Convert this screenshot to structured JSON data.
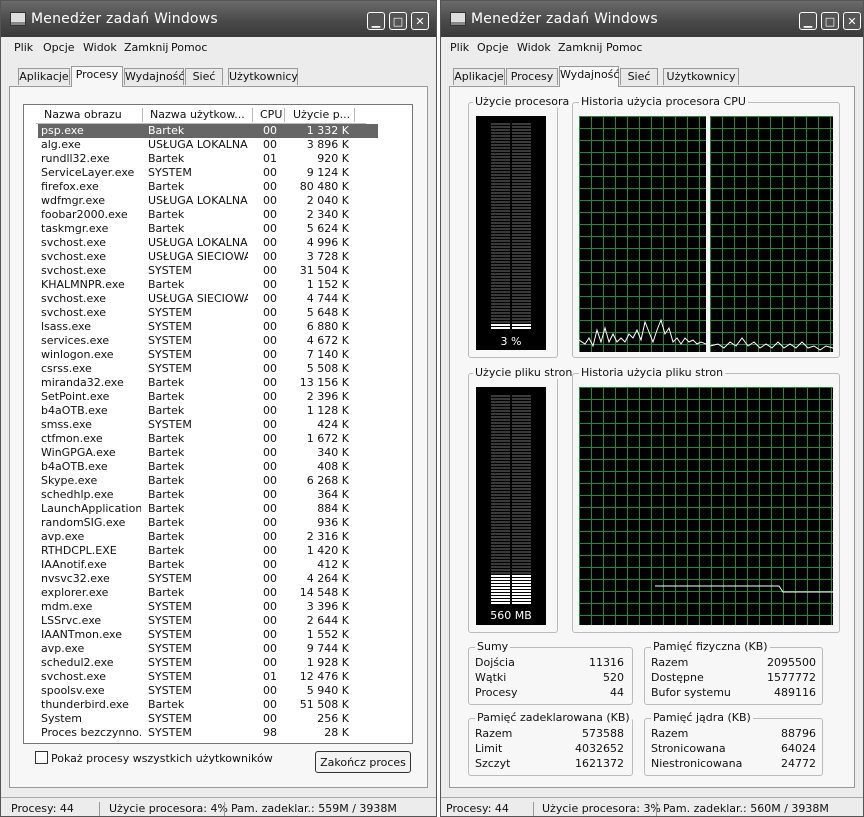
{
  "title": "Menedżer zadań Windows",
  "menu": [
    "Plik",
    "Opcje",
    "Widok",
    "Zamknij",
    "Pomoc"
  ],
  "tabs": [
    "Aplikacje",
    "Procesy",
    "Wydajność",
    "Sieć",
    "Użytkownicy"
  ],
  "processes": {
    "columns": [
      "Nazwa obrazu",
      "Nazwa użytkow...",
      "CPU",
      "Użycie p..."
    ],
    "rows": [
      [
        "psp.exe",
        "Bartek",
        "00",
        "1 332 K"
      ],
      [
        "alg.exe",
        "USŁUGA LOKALNA",
        "00",
        "3 896 K"
      ],
      [
        "rundll32.exe",
        "Bartek",
        "01",
        "920 K"
      ],
      [
        "ServiceLayer.exe",
        "SYSTEM",
        "00",
        "9 124 K"
      ],
      [
        "firefox.exe",
        "Bartek",
        "00",
        "80 480 K"
      ],
      [
        "wdfmgr.exe",
        "USŁUGA LOKALNA",
        "00",
        "2 040 K"
      ],
      [
        "foobar2000.exe",
        "Bartek",
        "00",
        "2 340 K"
      ],
      [
        "taskmgr.exe",
        "Bartek",
        "00",
        "5 624 K"
      ],
      [
        "svchost.exe",
        "USŁUGA LOKALNA",
        "00",
        "4 996 K"
      ],
      [
        "svchost.exe",
        "USŁUGA SIECIOWA",
        "00",
        "3 728 K"
      ],
      [
        "svchost.exe",
        "SYSTEM",
        "00",
        "31 504 K"
      ],
      [
        "KHALMNPR.exe",
        "Bartek",
        "00",
        "1 152 K"
      ],
      [
        "svchost.exe",
        "USŁUGA SIECIOWA",
        "00",
        "4 744 K"
      ],
      [
        "svchost.exe",
        "SYSTEM",
        "00",
        "5 648 K"
      ],
      [
        "lsass.exe",
        "SYSTEM",
        "00",
        "6 880 K"
      ],
      [
        "services.exe",
        "SYSTEM",
        "00",
        "4 672 K"
      ],
      [
        "winlogon.exe",
        "SYSTEM",
        "00",
        "7 140 K"
      ],
      [
        "csrss.exe",
        "SYSTEM",
        "00",
        "5 508 K"
      ],
      [
        "miranda32.exe",
        "Bartek",
        "00",
        "13 156 K"
      ],
      [
        "SetPoint.exe",
        "Bartek",
        "00",
        "2 396 K"
      ],
      [
        "b4aOTB.exe",
        "Bartek",
        "00",
        "1 128 K"
      ],
      [
        "smss.exe",
        "SYSTEM",
        "00",
        "424 K"
      ],
      [
        "ctfmon.exe",
        "Bartek",
        "00",
        "1 672 K"
      ],
      [
        "WinGPGA.exe",
        "Bartek",
        "00",
        "340 K"
      ],
      [
        "b4aOTB.exe",
        "Bartek",
        "00",
        "408 K"
      ],
      [
        "Skype.exe",
        "Bartek",
        "00",
        "6 268 K"
      ],
      [
        "schedhlp.exe",
        "Bartek",
        "00",
        "364 K"
      ],
      [
        "LaunchApplication...",
        "Bartek",
        "00",
        "884 K"
      ],
      [
        "randomSIG.exe",
        "Bartek",
        "00",
        "936 K"
      ],
      [
        "avp.exe",
        "Bartek",
        "00",
        "2 316 K"
      ],
      [
        "RTHDCPL.EXE",
        "Bartek",
        "00",
        "1 420 K"
      ],
      [
        "IAAnotif.exe",
        "Bartek",
        "00",
        "412 K"
      ],
      [
        "nvsvc32.exe",
        "SYSTEM",
        "00",
        "4 264 K"
      ],
      [
        "explorer.exe",
        "Bartek",
        "00",
        "14 548 K"
      ],
      [
        "mdm.exe",
        "SYSTEM",
        "00",
        "3 396 K"
      ],
      [
        "LSSrvc.exe",
        "SYSTEM",
        "00",
        "2 644 K"
      ],
      [
        "IAANTmon.exe",
        "SYSTEM",
        "00",
        "1 552 K"
      ],
      [
        "avp.exe",
        "SYSTEM",
        "00",
        "9 744 K"
      ],
      [
        "schedul2.exe",
        "SYSTEM",
        "00",
        "1 928 K"
      ],
      [
        "svchost.exe",
        "SYSTEM",
        "01",
        "12 476 K"
      ],
      [
        "spoolsv.exe",
        "SYSTEM",
        "00",
        "5 940 K"
      ],
      [
        "thunderbird.exe",
        "Bartek",
        "00",
        "51 508 K"
      ],
      [
        "System",
        "SYSTEM",
        "00",
        "256 K"
      ],
      [
        "Proces bezczynno...",
        "SYSTEM",
        "98",
        "28 K"
      ]
    ],
    "selected_index": 0,
    "show_all_label": "Pokaż procesy wszystkich użytkowników",
    "end_button": "Zakończ proces"
  },
  "status_left": {
    "processes": "Procesy: 44",
    "cpu": "Użycie procesora: 4%",
    "commit": "Pam. zadeklar.: 559M / 3938M"
  },
  "performance": {
    "cpu_usage_label": "Użycie procesora",
    "cpu_usage_value": "3 %",
    "cpu_usage_fraction": 0.03,
    "cpu_history_label": "Historia użycia procesora CPU",
    "pf_usage_label": "Użycie pliku stron",
    "pf_usage_value": "560 MB",
    "pf_usage_fraction": 0.14,
    "pf_history_label": "Historia użycia pliku stron",
    "totals": {
      "label": "Sumy",
      "items": [
        [
          "Dojścia",
          "11316"
        ],
        [
          "Wątki",
          "520"
        ],
        [
          "Procesy",
          "44"
        ]
      ]
    },
    "physical": {
      "label": "Pamięć fizyczna (KB)",
      "items": [
        [
          "Razem",
          "2095500"
        ],
        [
          "Dostępne",
          "1577772"
        ],
        [
          "Bufor systemu",
          "489116"
        ]
      ]
    },
    "commit": {
      "label": "Pamięć zadeklarowana (KB)",
      "items": [
        [
          "Razem",
          "573588"
        ],
        [
          "Limit",
          "4032652"
        ],
        [
          "Szczyt",
          "1621372"
        ]
      ]
    },
    "kernel": {
      "label": "Pamięć jądra (KB)",
      "items": [
        [
          "Razem",
          "88796"
        ],
        [
          "Stronicowana",
          "64024"
        ],
        [
          "Niestronicowana",
          "24772"
        ]
      ]
    }
  },
  "status_right": {
    "processes": "Procesy: 44",
    "cpu": "Użycie procesora: 3%",
    "commit": "Pam. zadeklar.: 560M / 3938M"
  },
  "icons": [
    "taskmgr-icon",
    "minimize-icon",
    "maximize-icon",
    "close-icon"
  ],
  "colors": {
    "graph_grid": "#1e8a3a",
    "graph_line": "#ffffff",
    "meter": "#ffffff",
    "title_bar": "#4a4a4a"
  }
}
